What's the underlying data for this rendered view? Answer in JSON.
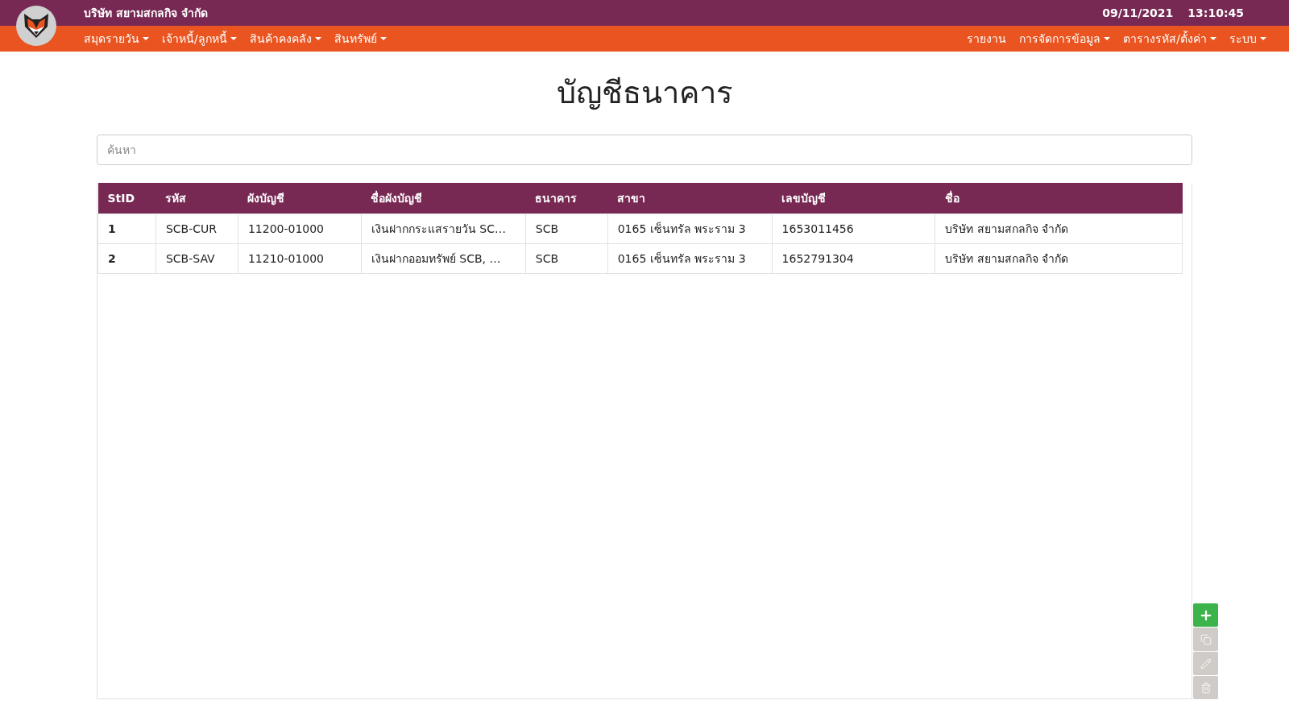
{
  "header": {
    "company": "บริษัท สยามสกลกิจ จำกัด",
    "date": "09/11/2021",
    "time": "13:10:45"
  },
  "menu_left": [
    {
      "label": "สมุดรายวัน",
      "dropdown": true
    },
    {
      "label": "เจ้าหนี้/ลูกหนี้",
      "dropdown": true
    },
    {
      "label": "สินค้าคงคลัง",
      "dropdown": true
    },
    {
      "label": "สินทรัพย์",
      "dropdown": true
    }
  ],
  "menu_right": [
    {
      "label": "รายงาน",
      "dropdown": false
    },
    {
      "label": "การจัดการข้อมูล",
      "dropdown": true
    },
    {
      "label": "ตารางรหัส/ตั้งค่า",
      "dropdown": true
    },
    {
      "label": "ระบบ",
      "dropdown": true
    }
  ],
  "page_title": "บัญชีธนาคาร",
  "search": {
    "placeholder": "ค้นหา"
  },
  "table": {
    "columns": [
      "StID",
      "รหัส",
      "ผังบัญชี",
      "ชื่อผังบัญชี",
      "ธนาคาร",
      "สาขา",
      "เลขบัญชี",
      "ชื่อ"
    ],
    "rows": [
      [
        "1",
        "SCB-CUR",
        "11200-01000",
        "เงินฝากกระแสรายวัน SC…",
        "SCB",
        "0165 เซ็นทรัล พระราม 3",
        "1653011456",
        "บริษัท สยามสกลกิจ จำกัด"
      ],
      [
        "2",
        "SCB-SAV",
        "11210-01000",
        "เงินฝากออมทรัพย์ SCB, …",
        "SCB",
        "0165 เซ็นทรัล พระราม 3",
        "1652791304",
        "บริษัท สยามสกลกิจ จำกัด"
      ]
    ]
  },
  "actions": [
    {
      "kind": "add",
      "disabled": false
    },
    {
      "kind": "copy",
      "disabled": true
    },
    {
      "kind": "edit",
      "disabled": true
    },
    {
      "kind": "delete",
      "disabled": true
    }
  ]
}
